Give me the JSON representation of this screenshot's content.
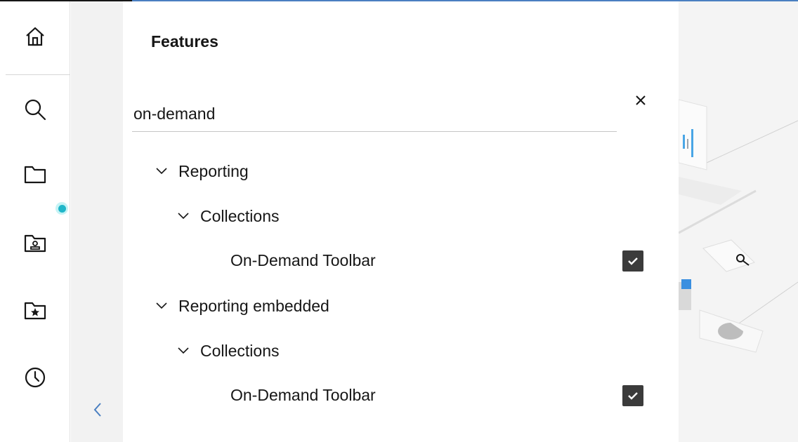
{
  "rail": {
    "items": [
      {
        "icon": "home-icon"
      },
      {
        "icon": "search-icon"
      },
      {
        "icon": "folder-icon"
      },
      {
        "icon": "team-folder-icon"
      },
      {
        "icon": "favorites-folder-icon"
      },
      {
        "icon": "recent-clock-icon"
      }
    ]
  },
  "panel": {
    "title": "Features",
    "search": {
      "value": "on-demand",
      "placeholder": ""
    },
    "tree": [
      {
        "label": "Reporting",
        "children": [
          {
            "label": "Collections",
            "children": [
              {
                "label": "On-Demand Toolbar",
                "checked": true
              }
            ]
          }
        ]
      },
      {
        "label": "Reporting embedded",
        "children": [
          {
            "label": "Collections",
            "children": [
              {
                "label": "On-Demand Toolbar",
                "checked": true
              }
            ]
          }
        ]
      }
    ]
  },
  "colors": {
    "accent_blue": "#4a7fc1",
    "notification_teal": "#1fb6c9",
    "checkbox_fill": "#3b3b3b",
    "gutter_gray": "#f2f2f2"
  }
}
